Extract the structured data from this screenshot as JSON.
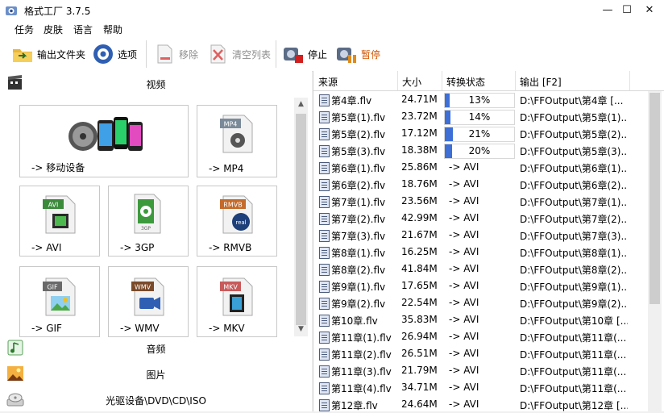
{
  "window": {
    "title": "格式工厂 3.7.5",
    "minimize": "—",
    "maximize": "☐",
    "close": "✕"
  },
  "menu": [
    "任务",
    "皮肤",
    "语言",
    "帮助"
  ],
  "toolbar": {
    "output_folder": "输出文件夹",
    "options": "选项",
    "remove": "移除",
    "clear_list": "清空列表",
    "stop": "停止",
    "pause": "暂停"
  },
  "categories": {
    "video": "视频",
    "audio": "音频",
    "picture": "图片",
    "optical": "光驱设备\\DVD\\CD\\ISO"
  },
  "tiles": [
    {
      "label": "-> 移动设备"
    },
    {
      "label": "-> MP4",
      "badge": "MP4"
    },
    {
      "label": "-> AVI",
      "badge": "AVI"
    },
    {
      "label": "-> 3GP",
      "badge": "3GP"
    },
    {
      "label": "-> RMVB",
      "badge": "RMVB"
    },
    {
      "label": "-> GIF",
      "badge": "GIF"
    },
    {
      "label": "-> WMV",
      "badge": "WMV"
    },
    {
      "label": "-> MKV",
      "badge": "MKV"
    }
  ],
  "table": {
    "columns": [
      "来源",
      "大小",
      "转换状态",
      "输出 [F2]"
    ],
    "rows": [
      {
        "src": "第4章.flv",
        "size": "24.71M",
        "status": "13%",
        "progress": 13,
        "out": "D:\\FFOutput\\第4章 [..."
      },
      {
        "src": "第5章(1).flv",
        "size": "23.72M",
        "status": "14%",
        "progress": 14,
        "out": "D:\\FFOutput\\第5章(1)..."
      },
      {
        "src": "第5章(2).flv",
        "size": "17.12M",
        "status": "21%",
        "progress": 21,
        "out": "D:\\FFOutput\\第5章(2)..."
      },
      {
        "src": "第5章(3).flv",
        "size": "18.38M",
        "status": "20%",
        "progress": 20,
        "out": "D:\\FFOutput\\第5章(3)..."
      },
      {
        "src": "第6章(1).flv",
        "size": "25.86M",
        "status": "-> AVI",
        "out": "D:\\FFOutput\\第6章(1)..."
      },
      {
        "src": "第6章(2).flv",
        "size": "18.76M",
        "status": "-> AVI",
        "out": "D:\\FFOutput\\第6章(2)..."
      },
      {
        "src": "第7章(1).flv",
        "size": "23.56M",
        "status": "-> AVI",
        "out": "D:\\FFOutput\\第7章(1)..."
      },
      {
        "src": "第7章(2).flv",
        "size": "42.99M",
        "status": "-> AVI",
        "out": "D:\\FFOutput\\第7章(2)..."
      },
      {
        "src": "第7章(3).flv",
        "size": "21.67M",
        "status": "-> AVI",
        "out": "D:\\FFOutput\\第7章(3)..."
      },
      {
        "src": "第8章(1).flv",
        "size": "16.25M",
        "status": "-> AVI",
        "out": "D:\\FFOutput\\第8章(1)..."
      },
      {
        "src": "第8章(2).flv",
        "size": "41.84M",
        "status": "-> AVI",
        "out": "D:\\FFOutput\\第8章(2)..."
      },
      {
        "src": "第9章(1).flv",
        "size": "17.65M",
        "status": "-> AVI",
        "out": "D:\\FFOutput\\第9章(1)..."
      },
      {
        "src": "第9章(2).flv",
        "size": "22.54M",
        "status": "-> AVI",
        "out": "D:\\FFOutput\\第9章(2)..."
      },
      {
        "src": "第10章.flv",
        "size": "35.83M",
        "status": "-> AVI",
        "out": "D:\\FFOutput\\第10章 [..."
      },
      {
        "src": "第11章(1).flv",
        "size": "26.94M",
        "status": "-> AVI",
        "out": "D:\\FFOutput\\第11章(..."
      },
      {
        "src": "第11章(2).flv",
        "size": "26.51M",
        "status": "-> AVI",
        "out": "D:\\FFOutput\\第11章(..."
      },
      {
        "src": "第11章(3).flv",
        "size": "21.79M",
        "status": "-> AVI",
        "out": "D:\\FFOutput\\第11章(..."
      },
      {
        "src": "第11章(4).flv",
        "size": "34.71M",
        "status": "-> AVI",
        "out": "D:\\FFOutput\\第11章(..."
      },
      {
        "src": "第12章.flv",
        "size": "24.64M",
        "status": "-> AVI",
        "out": "D:\\FFOutput\\第12章 [..."
      }
    ]
  },
  "colors": {
    "progress_fill": "#3d6fd6"
  }
}
